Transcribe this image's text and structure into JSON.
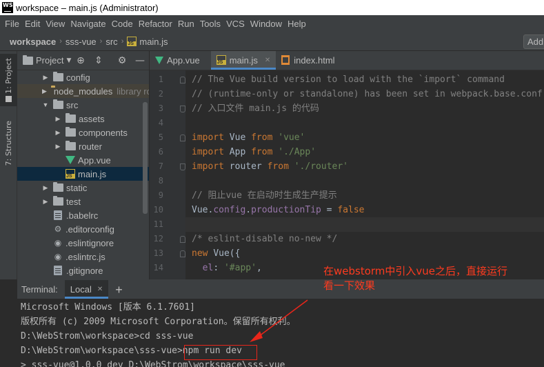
{
  "window": {
    "title": "workspace – main.js (Administrator)",
    "logo": "WS"
  },
  "menu": [
    "File",
    "Edit",
    "View",
    "Navigate",
    "Code",
    "Refactor",
    "Run",
    "Tools",
    "VCS",
    "Window",
    "Help"
  ],
  "breadcrumb": {
    "items": [
      "workspace",
      "sss-vue",
      "src",
      "main.js"
    ],
    "add_button": "Add"
  },
  "left_strip": {
    "project_tab": "1: Project",
    "structure_tab": "7: Structure"
  },
  "project_panel": {
    "title": "Project",
    "tree": [
      {
        "label": "config",
        "type": "folder",
        "depth": 1,
        "arrow": "▶"
      },
      {
        "label": "node_modules",
        "type": "folder-excluded",
        "depth": 1,
        "arrow": "▶",
        "suffix": "library root"
      },
      {
        "label": "src",
        "type": "folder",
        "depth": 1,
        "arrow": "▼"
      },
      {
        "label": "assets",
        "type": "folder",
        "depth": 2,
        "arrow": "▶"
      },
      {
        "label": "components",
        "type": "folder",
        "depth": 2,
        "arrow": "▶"
      },
      {
        "label": "router",
        "type": "folder",
        "depth": 2,
        "arrow": "▶"
      },
      {
        "label": "App.vue",
        "type": "vue",
        "depth": 2,
        "arrow": ""
      },
      {
        "label": "main.js",
        "type": "js",
        "depth": 2,
        "arrow": "",
        "selected": true
      },
      {
        "label": "static",
        "type": "folder",
        "depth": 1,
        "arrow": "▶"
      },
      {
        "label": "test",
        "type": "folder",
        "depth": 1,
        "arrow": "▶"
      },
      {
        "label": ".babelrc",
        "type": "file",
        "depth": 1,
        "arrow": ""
      },
      {
        "label": ".editorconfig",
        "type": "gear",
        "depth": 1,
        "arrow": ""
      },
      {
        "label": ".eslintignore",
        "type": "circle",
        "depth": 1,
        "arrow": ""
      },
      {
        "label": ".eslintrc.js",
        "type": "circle",
        "depth": 1,
        "arrow": ""
      },
      {
        "label": ".gitignore",
        "type": "file",
        "depth": 1,
        "arrow": ""
      }
    ]
  },
  "editor": {
    "tabs": [
      {
        "label": "App.vue",
        "icon": "vue-icon"
      },
      {
        "label": "main.js",
        "icon": "js-icon",
        "active": true
      },
      {
        "label": "index.html",
        "icon": "html-icon"
      }
    ],
    "lines": [
      [
        [
          "cm",
          "// The Vue build version to load with the `import` command"
        ]
      ],
      [
        [
          "cm",
          "// (runtime-only or standalone) has been set in webpack.base.conf with an alias."
        ]
      ],
      [
        [
          "cm",
          "// 入口文件 main.js 的代码"
        ]
      ],
      [],
      [
        [
          "kw",
          "import "
        ],
        [
          "pl",
          "Vue "
        ],
        [
          "kw",
          "from "
        ],
        [
          "st",
          "'vue'"
        ]
      ],
      [
        [
          "kw",
          "import "
        ],
        [
          "pl",
          "App "
        ],
        [
          "kw",
          "from "
        ],
        [
          "st",
          "'./App'"
        ]
      ],
      [
        [
          "kw",
          "import "
        ],
        [
          "pl",
          "router "
        ],
        [
          "kw",
          "from "
        ],
        [
          "st",
          "'./router'"
        ]
      ],
      [],
      [
        [
          "cm",
          "// 阻止vue 在启动时生成生产提示"
        ]
      ],
      [
        [
          "pl",
          "Vue."
        ],
        [
          "pr",
          "config"
        ],
        [
          "pl",
          "."
        ],
        [
          "pr",
          "productionTip"
        ],
        [
          "pl",
          " = "
        ],
        [
          "kw",
          "false"
        ]
      ],
      [],
      [
        [
          "cm",
          "/* eslint-disable no-new */"
        ]
      ],
      [
        [
          "kw",
          "new "
        ],
        [
          "pl",
          "Vue({"
        ]
      ],
      [
        [
          "pl",
          "  "
        ],
        [
          "pr",
          "el"
        ],
        [
          "pl",
          ": "
        ],
        [
          "st",
          "'#app'"
        ],
        [
          "pl",
          ","
        ]
      ]
    ],
    "current_line": 11
  },
  "terminal": {
    "label": "Terminal:",
    "tab": "Local",
    "lines": [
      "Microsoft Windows [版本 6.1.7601]",
      "版权所有 (c) 2009 Microsoft Corporation。保留所有权利。",
      "D:\\WebStrom\\workspace>cd sss-vue",
      "D:\\WebStrom\\workspace\\sss-vue>npm run dev",
      "> sss-vue@1.0.0 dev D:\\WebStrom\\workspace\\sss-vue"
    ]
  },
  "annotation": {
    "line1": "在webstorm中引入vue之后，直接运行",
    "line2": "看一下效果",
    "color": "#ff3b1f"
  }
}
